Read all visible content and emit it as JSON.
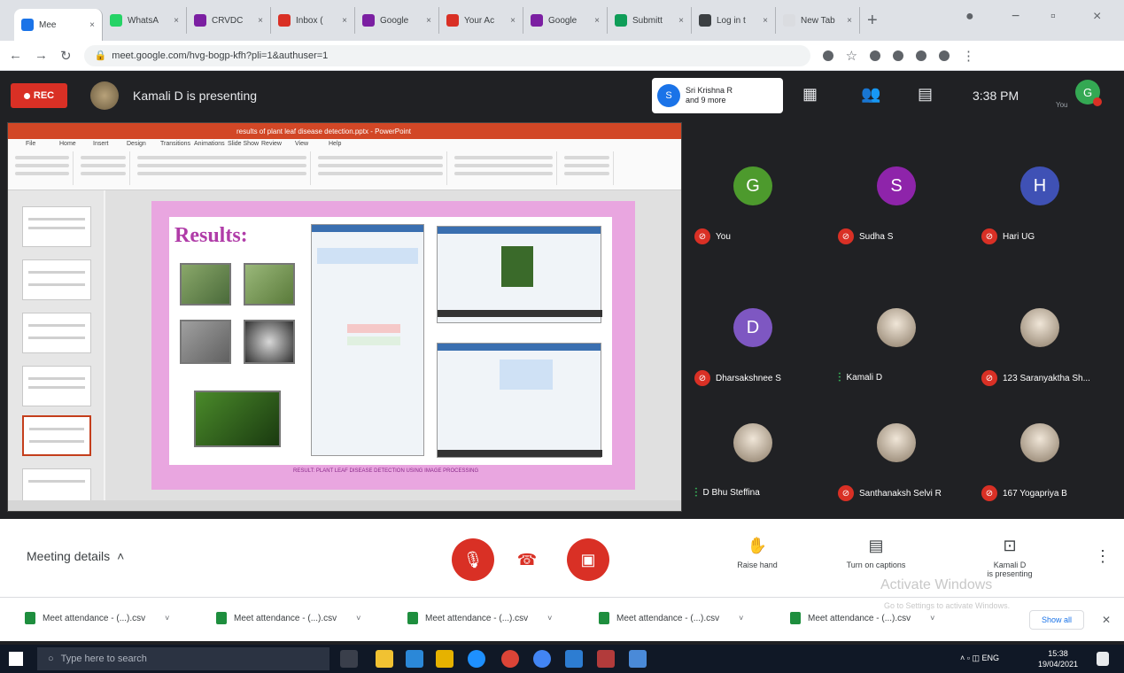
{
  "browser": {
    "tabs": [
      {
        "label": "Mee",
        "color": "#1a73e8",
        "active": true
      },
      {
        "label": "WhatsA",
        "color": "#25d366"
      },
      {
        "label": "CRVDC",
        "color": "#7b1fa2"
      },
      {
        "label": "Inbox (",
        "color": "#d93025"
      },
      {
        "label": "Google",
        "color": "#7b1fa2"
      },
      {
        "label": "Your Ac",
        "color": "#d93025"
      },
      {
        "label": "Google",
        "color": "#7b1fa2"
      },
      {
        "label": "Submitt",
        "color": "#0f9d58"
      },
      {
        "label": "Log in t",
        "color": "#3c4043"
      },
      {
        "label": "New Tab",
        "color": "#dadce0"
      }
    ],
    "url": "meet.google.com/hvg-bogp-kfh?pli=1&authuser=1"
  },
  "meet": {
    "rec_label": "REC",
    "presenting_text": "Kamali D is presenting",
    "others_initial": "S",
    "others_line1": "Sri Krishna R",
    "others_line2": "and 9 more",
    "clock": "3:38 PM",
    "self_initial": "G",
    "self_label": "You"
  },
  "presentation": {
    "window_title": "results of plant leaf disease detection.pptx - PowerPoint",
    "ribbon_tabs": [
      "File",
      "Home",
      "Insert",
      "Design",
      "Transitions",
      "Animations",
      "Slide Show",
      "Review",
      "View",
      "Help"
    ],
    "slide_title": "Results:",
    "slide_caption": "RESULT: PLANT LEAF DISEASE DETECTION USING IMAGE PROCESSING"
  },
  "participants": [
    {
      "initial": "G",
      "name": "You",
      "color": "#4d9a2d",
      "muted": true
    },
    {
      "initial": "S",
      "name": "Sudha S",
      "color": "#8e24aa",
      "muted": true
    },
    {
      "initial": "H",
      "name": "Hari UG",
      "color": "#3f51b5",
      "muted": true
    },
    {
      "initial": "D",
      "name": "Dharsakshnee S",
      "color": "#7e57c2",
      "muted": true
    },
    {
      "initial": "",
      "name": "Kamali D",
      "color": "photo",
      "muted": false
    },
    {
      "initial": "",
      "name": "123 Saranyaktha Sh...",
      "color": "photo",
      "muted": true
    },
    {
      "initial": "",
      "name": "D Bhu Steffina",
      "color": "photo",
      "muted": false
    },
    {
      "initial": "",
      "name": "Santhanaksh Selvi R",
      "color": "photo",
      "muted": true
    },
    {
      "initial": "",
      "name": "167 Yogapriya B",
      "color": "photo",
      "muted": true
    }
  ],
  "controls": {
    "meeting_details": "Meeting details",
    "raise_hand": "Raise hand",
    "captions": "Turn on captions",
    "presenting_line1": "Kamali D",
    "presenting_line2": "is presenting",
    "activate_title": "Activate Windows",
    "activate_sub": "Go to Settings to activate Windows."
  },
  "downloads": {
    "items": [
      "Meet attendance - (...).csv",
      "Meet attendance - (...).csv",
      "Meet attendance - (...).csv",
      "Meet attendance - (...).csv",
      "Meet attendance - (...).csv"
    ],
    "show_all": "Show all"
  },
  "taskbar": {
    "search_placeholder": "Type here to search",
    "tray": "ENG",
    "time": "15:38",
    "date": "19/04/2021"
  }
}
